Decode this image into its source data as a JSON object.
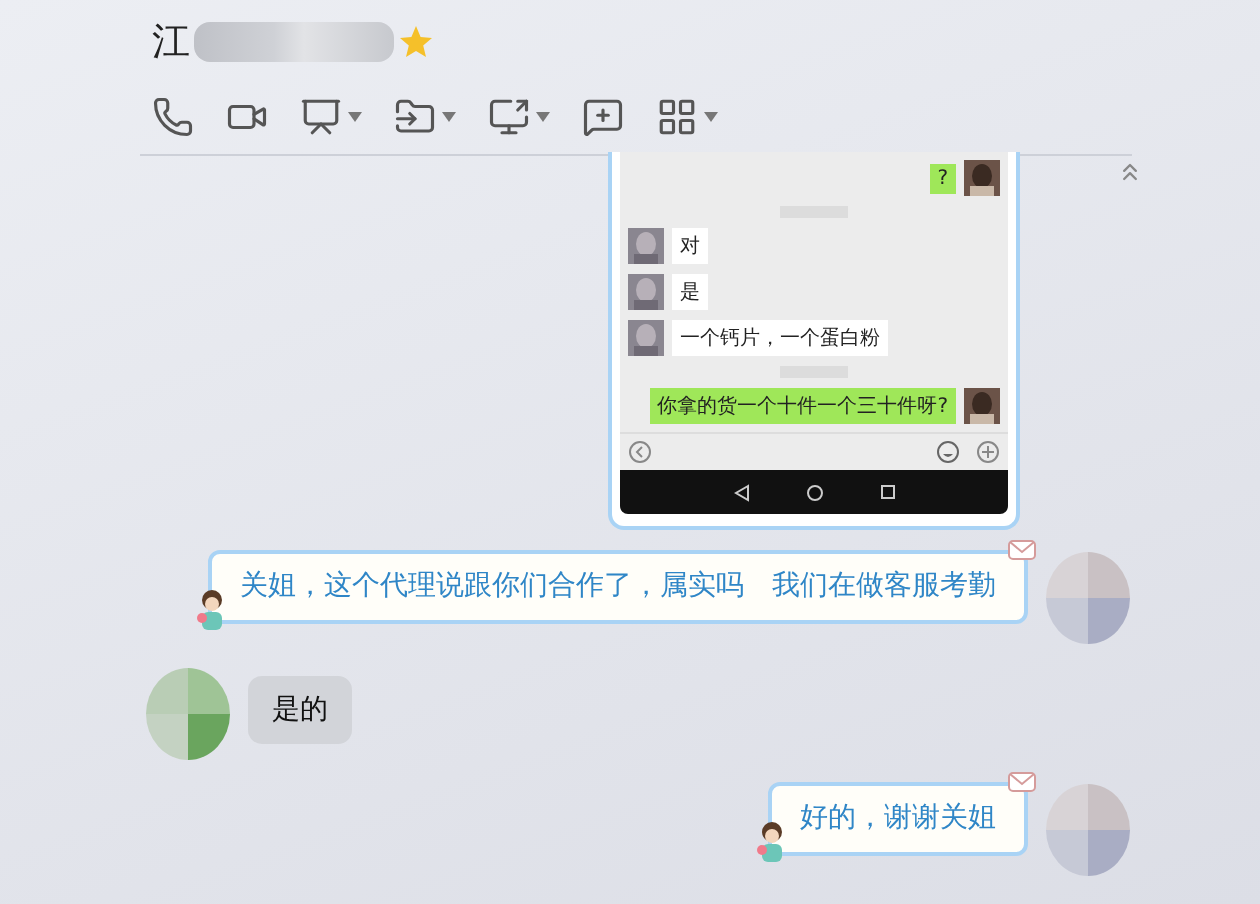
{
  "contact": {
    "name": "江",
    "starred": true
  },
  "toolbar": [
    {
      "kind": "phone",
      "dropdown": false
    },
    {
      "kind": "video",
      "dropdown": false
    },
    {
      "kind": "present",
      "dropdown": true
    },
    {
      "kind": "file",
      "dropdown": true
    },
    {
      "kind": "share",
      "dropdown": true
    },
    {
      "kind": "note",
      "dropdown": false
    },
    {
      "kind": "apps",
      "dropdown": true
    }
  ],
  "messages": [
    {
      "outgoing": true,
      "screenshot": [
        {
          "outgoing": true,
          "text": "?"
        },
        {
          "outgoing": false,
          "text": "对"
        },
        {
          "outgoing": false,
          "text": "是"
        },
        {
          "outgoing": false,
          "text": "一个钙片，一个蛋白粉"
        },
        {
          "outgoing": true,
          "text": "你拿的货一个十件一个三十件呀?"
        }
      ]
    },
    {
      "kind": "text",
      "outgoing": true,
      "text": "关姐，这个代理说跟你们合作了，属实吗　我们在做客服考勤"
    },
    {
      "kind": "text",
      "outgoing": false,
      "text": "是的"
    },
    {
      "kind": "text",
      "outgoing": true,
      "text": "好的，谢谢关姐"
    }
  ]
}
